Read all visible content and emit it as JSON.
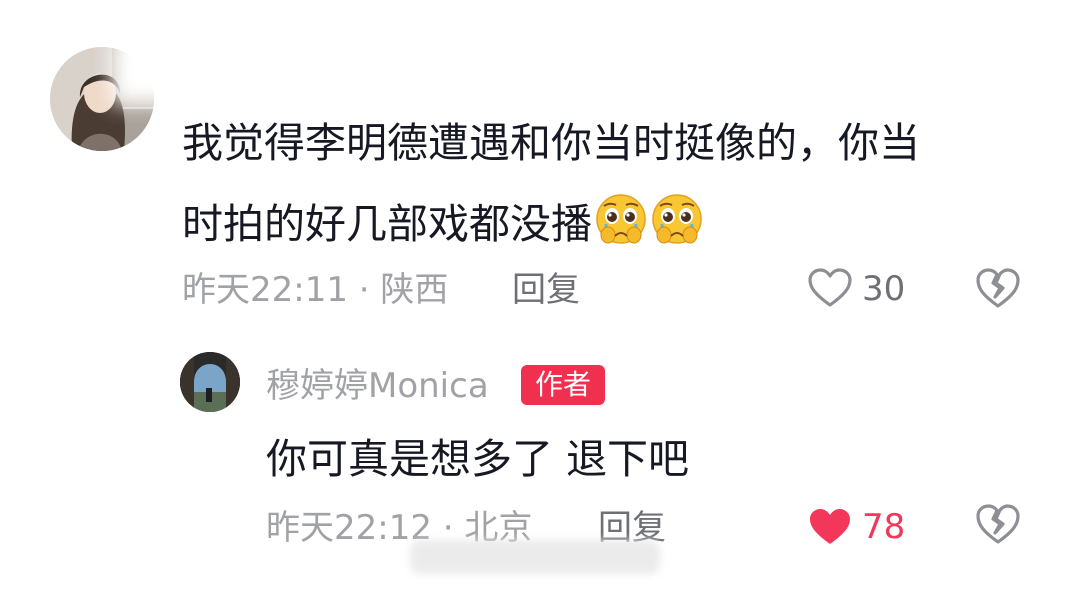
{
  "comment": {
    "text_line1": "我觉得李明德遭遇和你当时挺像的，你当",
    "text_line2": "时拍的好几部戏都没播",
    "emojis": [
      "pleading-face-icon",
      "pleading-face-icon"
    ],
    "time": "昨天22:11",
    "separator": "·",
    "location": "陕西",
    "reply_label": "回复",
    "likes": "30",
    "liked": false
  },
  "reply": {
    "author": "穆婷婷Monica",
    "badge": "作者",
    "text": "你可真是想多了 退下吧",
    "time": "昨天22:12",
    "separator": "·",
    "location": "北京",
    "reply_label": "回复",
    "likes": "78",
    "liked": true
  },
  "colors": {
    "text_primary": "#161823",
    "text_secondary": "#a1a2a6",
    "like_active": "#f2375a",
    "badge_bg": "#f1304f"
  }
}
